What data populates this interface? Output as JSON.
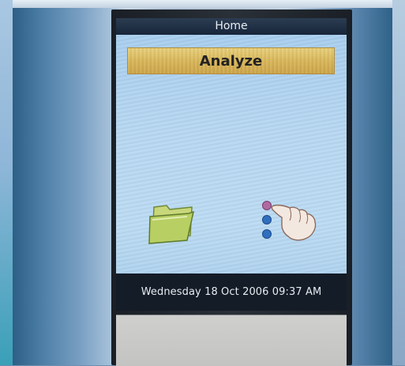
{
  "screen": {
    "title": "Home",
    "primary_action_label": "Analyze",
    "icons": [
      {
        "name": "folder-icon",
        "role": "open files"
      },
      {
        "name": "hand-menu-icon",
        "role": "menu / options"
      }
    ],
    "status_bar": {
      "datetime": "Wednesday 18 Oct 2006 09:37  AM"
    }
  },
  "colors": {
    "title_bar": "#17253a",
    "screen_bg": "#b8d8f2",
    "button_gold": "#d9b75a",
    "status_bar": "#141c27"
  }
}
